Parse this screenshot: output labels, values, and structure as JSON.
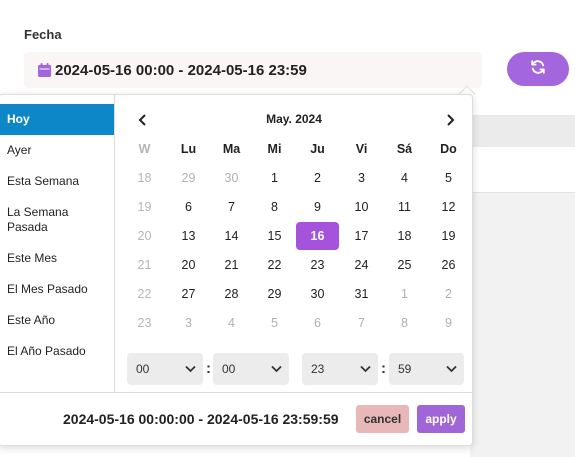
{
  "field": {
    "label": "Fecha",
    "value": "2024-05-16 00:00 - 2024-05-16 23:59",
    "icon": "calendar-icon",
    "refresh_icon": "refresh-icon"
  },
  "colors": {
    "accent": "#a466dc",
    "range_active": "#0e87c9",
    "cancel": "#e8b7b7",
    "apply": "#a066d8"
  },
  "ranges": [
    {
      "label": "Hoy",
      "active": true
    },
    {
      "label": "Ayer"
    },
    {
      "label": "Esta Semana"
    },
    {
      "label": "La Semana Pasada"
    },
    {
      "label": "Este Mes"
    },
    {
      "label": "El Mes Pasado"
    },
    {
      "label": "Este Año"
    },
    {
      "label": "El Año Pasado"
    }
  ],
  "calendar": {
    "month": "May. 2024",
    "headers": [
      "W",
      "Lu",
      "Ma",
      "Mi",
      "Ju",
      "Vi",
      "Sá",
      "Do"
    ],
    "weeks": [
      {
        "wk": "18",
        "days": [
          {
            "d": "29",
            "off": true
          },
          {
            "d": "30",
            "off": true
          },
          {
            "d": "1"
          },
          {
            "d": "2"
          },
          {
            "d": "3"
          },
          {
            "d": "4"
          },
          {
            "d": "5"
          }
        ]
      },
      {
        "wk": "19",
        "days": [
          {
            "d": "6"
          },
          {
            "d": "7"
          },
          {
            "d": "8"
          },
          {
            "d": "9"
          },
          {
            "d": "10"
          },
          {
            "d": "11"
          },
          {
            "d": "12"
          }
        ]
      },
      {
        "wk": "20",
        "days": [
          {
            "d": "13"
          },
          {
            "d": "14"
          },
          {
            "d": "15"
          },
          {
            "d": "16",
            "sel": true
          },
          {
            "d": "17"
          },
          {
            "d": "18"
          },
          {
            "d": "19"
          }
        ]
      },
      {
        "wk": "21",
        "days": [
          {
            "d": "20"
          },
          {
            "d": "21"
          },
          {
            "d": "22"
          },
          {
            "d": "23"
          },
          {
            "d": "24"
          },
          {
            "d": "25"
          },
          {
            "d": "26"
          }
        ]
      },
      {
        "wk": "22",
        "days": [
          {
            "d": "27"
          },
          {
            "d": "28"
          },
          {
            "d": "29"
          },
          {
            "d": "30"
          },
          {
            "d": "31"
          },
          {
            "d": "1",
            "off": true
          },
          {
            "d": "2",
            "off": true
          }
        ]
      },
      {
        "wk": "23",
        "days": [
          {
            "d": "3",
            "off": true
          },
          {
            "d": "4",
            "off": true
          },
          {
            "d": "5",
            "off": true
          },
          {
            "d": "6",
            "off": true
          },
          {
            "d": "7",
            "off": true
          },
          {
            "d": "8",
            "off": true
          },
          {
            "d": "9",
            "off": true
          }
        ]
      }
    ]
  },
  "time": {
    "start_hour": "00",
    "start_minute": "00",
    "end_hour": "23",
    "end_minute": "59",
    "separator": ":"
  },
  "footer": {
    "range": "2024-05-16 00:00:00 - 2024-05-16 23:59:59",
    "cancel_label": "cancel",
    "apply_label": "apply"
  }
}
